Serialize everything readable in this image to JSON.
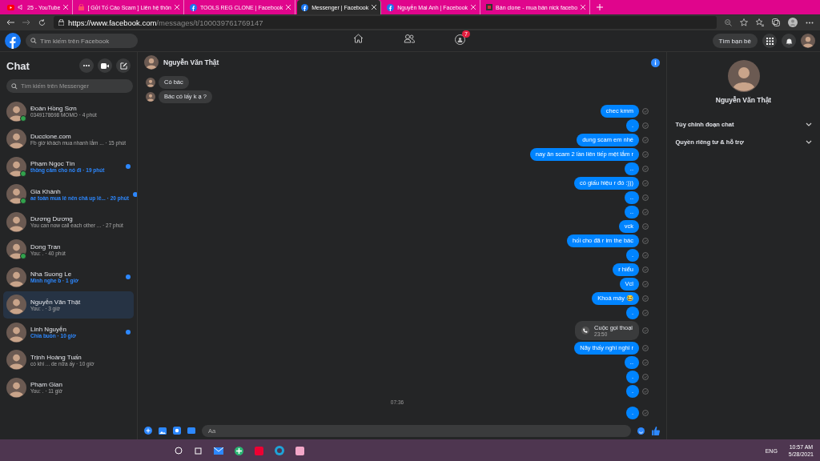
{
  "browser": {
    "tabs": [
      {
        "title": "25 - YouTube",
        "selected": false,
        "audio": true
      },
      {
        "title": "[ Gửi Tố Cáo Scam ] Liên hệ thôn",
        "selected": false,
        "audio": false
      },
      {
        "title": "TOOLS REG CLONE | Facebook",
        "selected": false,
        "audio": false
      },
      {
        "title": "Messenger | Facebook",
        "selected": true,
        "audio": false
      },
      {
        "title": "Nguyễn Mai Anh | Facebook",
        "selected": false,
        "audio": false
      },
      {
        "title": "Bán clone - mua bán nick facebo",
        "selected": false,
        "audio": false
      }
    ],
    "url_host": "https://www.facebook.com",
    "url_path": "/messages/t/100039761769147"
  },
  "header": {
    "search_placeholder": "Tìm kiếm trên Facebook",
    "groups_badge": "7",
    "find_friends": "Tìm bạn bè"
  },
  "sidebar": {
    "title": "Chat",
    "search_placeholder": "Tìm kiếm trên Messenger",
    "conversations": [
      {
        "name": "Đoàn Hồng Sơn",
        "preview": "0349178698 MOMO · 4 phút",
        "online": true,
        "unread": false,
        "selected": false
      },
      {
        "name": "Ducclone.com",
        "preview": "Fb giờ khách mua nhanh lắm ... · 15 phút",
        "online": false,
        "unread": false,
        "selected": false
      },
      {
        "name": "Phạm Ngọc Tín",
        "preview": "thông cảm cho nó đi · 19 phút",
        "online": true,
        "unread": true,
        "selected": false
      },
      {
        "name": "Gia Khánh",
        "preview": "ae toàn mua lẻ nên chả up lẻ... · 20 phút",
        "online": true,
        "unread": true,
        "selected": false
      },
      {
        "name": "Dương Dương",
        "preview": "You can now call each other ... · 27 phút",
        "online": false,
        "unread": false,
        "selected": false
      },
      {
        "name": "Dong Tran",
        "preview": "You: . · 40 phút",
        "online": true,
        "unread": false,
        "selected": false
      },
      {
        "name": "Nha Suong Le",
        "preview": "Mình nghe b · 1 giờ",
        "online": false,
        "unread": true,
        "selected": false
      },
      {
        "name": "Nguyễn Văn Thật",
        "preview": "You: . · 3 giờ",
        "online": false,
        "unread": false,
        "selected": true
      },
      {
        "name": "Linh Nguyễn",
        "preview": "Chia buồn · 10 giờ",
        "online": false,
        "unread": true,
        "selected": false
      },
      {
        "name": "Trịnh Hoàng Tuấn",
        "preview": "có khi ... de nữa ấy · 10 giờ",
        "online": false,
        "unread": false,
        "selected": false
      },
      {
        "name": "Phạm Gian",
        "preview": "You: . · 11 giờ",
        "online": false,
        "unread": false,
        "selected": false
      }
    ]
  },
  "chat": {
    "contact": "Nguyễn Văn Thật",
    "composer_placeholder": "Aa",
    "messages": [
      {
        "kind": "received",
        "text": "Có bác"
      },
      {
        "kind": "received",
        "text": "Bác có lấy k ạ ?"
      },
      {
        "kind": "sent",
        "text": "chec kmm"
      },
      {
        "kind": "sent",
        "text": "."
      },
      {
        "kind": "sent",
        "text": "dung scam em nhé"
      },
      {
        "kind": "sent",
        "text": "nay ăn scam 2 lần liên tiếp mệt lắm r"
      },
      {
        "kind": "sent",
        "text": ".."
      },
      {
        "kind": "sent",
        "text": "có giấu hiệu r đó :)))"
      },
      {
        "kind": "sent",
        "text": ".."
      },
      {
        "kind": "sent",
        "text": ".."
      },
      {
        "kind": "sent",
        "text": "vck"
      },
      {
        "kind": "sent",
        "text": "hối cho đã r im the bác"
      },
      {
        "kind": "sent",
        "text": "."
      },
      {
        "kind": "sent",
        "text": "r hiểu"
      },
      {
        "kind": "sent",
        "text": "Vcl"
      },
      {
        "kind": "sent",
        "text": "Khoá máy 😂"
      },
      {
        "kind": "sent",
        "text": "."
      },
      {
        "kind": "call",
        "text": "Cuộc gọi thoại",
        "time": "23:50"
      },
      {
        "kind": "sent",
        "text": "Nãy thấy nghi nghi r"
      },
      {
        "kind": "sent",
        "text": ".."
      },
      {
        "kind": "sent",
        "text": "."
      },
      {
        "kind": "sent",
        "text": "."
      },
      {
        "kind": "timestamp",
        "text": "07:36"
      },
      {
        "kind": "sent",
        "text": "."
      }
    ]
  },
  "details": {
    "name": "Nguyễn Văn Thật",
    "sections": [
      "Tùy chỉnh đoạn chat",
      "Quyền riêng tư & hỗ trợ"
    ]
  },
  "taskbar": {
    "language": "ENG",
    "time": "10:57 AM",
    "date": "5/28/2021"
  }
}
